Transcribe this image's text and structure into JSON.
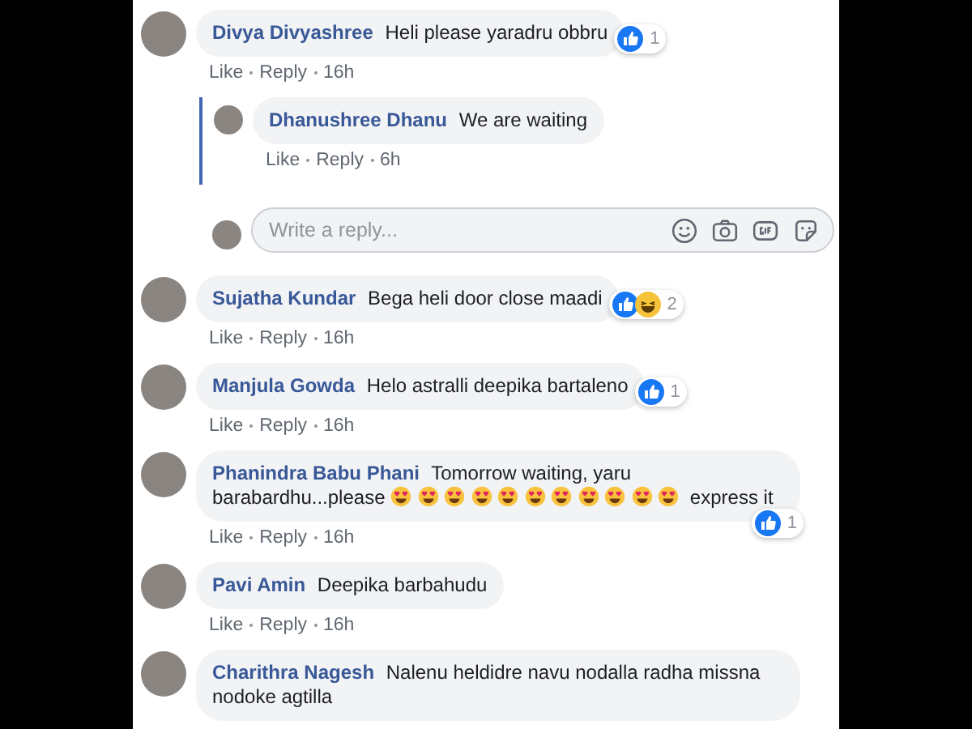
{
  "comments": [
    {
      "name": "Divya Divyashree",
      "parts": [
        {
          "kind": "text",
          "text": "Heli please yaradru obbru"
        }
      ],
      "reactions": {
        "kind": "inline",
        "icons": [
          {
            "kind": "like"
          }
        ],
        "count": "1"
      },
      "actions": [
        "Like",
        "Reply"
      ],
      "time": "16h",
      "replies": [
        {
          "name": "Dhanushree Dhanu",
          "parts": [
            {
              "kind": "text",
              "text": "We are waiting"
            }
          ],
          "actions": [
            "Like",
            "Reply"
          ],
          "time": "6h"
        }
      ],
      "reply_box": {
        "placeholder": "Write a reply..."
      }
    },
    {
      "name": "Sujatha Kundar",
      "parts": [
        {
          "kind": "text",
          "text": "Bega heli door close maadi"
        }
      ],
      "reactions": {
        "kind": "inline",
        "icons": [
          {
            "kind": "like"
          },
          {
            "kind": "haha"
          }
        ],
        "count": "2"
      },
      "actions": [
        "Like",
        "Reply"
      ],
      "time": "16h"
    },
    {
      "name": "Manjula Gowda",
      "parts": [
        {
          "kind": "text",
          "text": "Helo astralli deepika bartaleno"
        }
      ],
      "reactions": {
        "kind": "inline",
        "icons": [
          {
            "kind": "like"
          }
        ],
        "count": "1"
      },
      "actions": [
        "Like",
        "Reply"
      ],
      "time": "16h"
    },
    {
      "name": "Phanindra Babu Phani",
      "parts": [
        {
          "kind": "text",
          "text": "Tomorrow waiting, yaru barabardhu...please"
        },
        {
          "kind": "emoji"
        },
        {
          "kind": "emoji"
        },
        {
          "kind": "emoji"
        },
        {
          "kind": "emoji"
        },
        {
          "kind": "emoji"
        },
        {
          "kind": "emoji"
        },
        {
          "kind": "emoji"
        },
        {
          "kind": "emoji"
        },
        {
          "kind": "emoji"
        },
        {
          "kind": "emoji"
        },
        {
          "kind": "emoji"
        },
        {
          "kind": "text",
          "text": "express it"
        }
      ],
      "reactions": {
        "kind": "below",
        "icons": [
          {
            "kind": "like"
          }
        ],
        "count": "1"
      },
      "actions": [
        "Like",
        "Reply"
      ],
      "time": "16h"
    },
    {
      "name": "Pavi Amin",
      "parts": [
        {
          "kind": "text",
          "text": "Deepika barbahudu"
        }
      ],
      "actions": [
        "Like",
        "Reply"
      ],
      "time": "16h"
    },
    {
      "name": "Charithra Nagesh",
      "parts": [
        {
          "kind": "text",
          "text": "Nalenu heldidre navu nodalla radha missna nodoke agtilla"
        }
      ]
    }
  ]
}
